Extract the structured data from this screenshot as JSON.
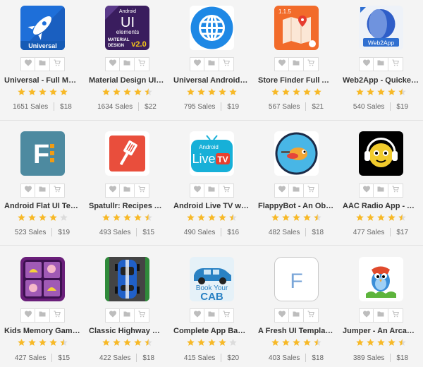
{
  "items": [
    {
      "title": "Universal - Full Multi...",
      "sales": "1651 Sales",
      "price": "$18",
      "rating": 5,
      "icon": "rocket-icon",
      "badge": "Universal"
    },
    {
      "title": "Material Design UI A...",
      "sales": "1634 Sales",
      "price": "$22",
      "rating": 4.5,
      "icon": "material-ui-icon",
      "lines": [
        "Android",
        "UI",
        "elements",
        "MATERIAL",
        "DESIGN"
      ],
      "version": "v2.0"
    },
    {
      "title": "Universal Android W...",
      "sales": "795 Sales",
      "price": "$19",
      "rating": 5,
      "icon": "globe-icon"
    },
    {
      "title": "Store Finder Full And...",
      "sales": "567 Sales",
      "price": "$21",
      "rating": 5,
      "icon": "map-icon",
      "version": "1.1.5"
    },
    {
      "title": "Web2App - Quickest...",
      "sales": "540 Sales",
      "price": "$19",
      "rating": 4.5,
      "icon": "web2app-icon",
      "badge": "Web2App"
    },
    {
      "title": "Android Flat UI Temp...",
      "sales": "523 Sales",
      "price": "$19",
      "rating": 4,
      "icon": "flat-ui-icon",
      "letter": "F"
    },
    {
      "title": "Spatullr: Recipes App...",
      "sales": "493 Sales",
      "price": "$15",
      "rating": 4.5,
      "icon": "spatula-icon"
    },
    {
      "title": "Android Live TV with...",
      "sales": "490 Sales",
      "price": "$16",
      "rating": 4.5,
      "icon": "live-tv-icon",
      "lines": [
        "Android",
        "Live",
        "TV"
      ]
    },
    {
      "title": "FlappyBot - An Obst...",
      "sales": "482 Sales",
      "price": "$18",
      "rating": 4.5,
      "icon": "flappybot-icon"
    },
    {
      "title": "AAC Radio App - An...",
      "sales": "477 Sales",
      "price": "$17",
      "rating": 4.5,
      "icon": "radio-mascot-icon"
    },
    {
      "title": "Kids Memory Game ...",
      "sales": "427 Sales",
      "price": "$15",
      "rating": 4.5,
      "icon": "memory-game-icon"
    },
    {
      "title": "Classic Highway Car...",
      "sales": "422 Sales",
      "price": "$18",
      "rating": 4.5,
      "icon": "racing-car-icon"
    },
    {
      "title": "Complete App Based...",
      "sales": "415 Sales",
      "price": "$20",
      "rating": 4,
      "icon": "cab-icon",
      "lines": [
        "Book Your",
        "CAB"
      ]
    },
    {
      "title": "A Fresh UI Template ...",
      "sales": "403 Sales",
      "price": "$18",
      "rating": 4.5,
      "icon": "fresh-ui-icon",
      "letter": "F"
    },
    {
      "title": "Jumper - An Arcade ...",
      "sales": "389 Sales",
      "price": "$18",
      "rating": 4.5,
      "icon": "jumper-bird-icon"
    }
  ],
  "colors": {
    "star": "#f7b928",
    "star_empty": "#dcdcdc",
    "action_icon": "#bdbdbd"
  }
}
